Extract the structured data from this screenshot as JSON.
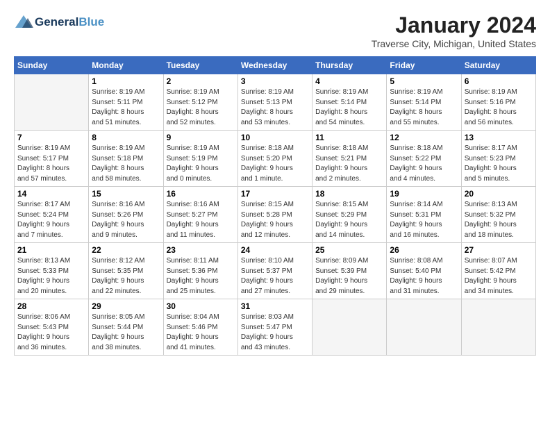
{
  "header": {
    "logo_line1": "General",
    "logo_line2": "Blue",
    "month_title": "January 2024",
    "location": "Traverse City, Michigan, United States"
  },
  "days_of_week": [
    "Sunday",
    "Monday",
    "Tuesday",
    "Wednesday",
    "Thursday",
    "Friday",
    "Saturday"
  ],
  "weeks": [
    [
      {
        "day": "",
        "info": ""
      },
      {
        "day": "1",
        "info": "Sunrise: 8:19 AM\nSunset: 5:11 PM\nDaylight: 8 hours\nand 51 minutes."
      },
      {
        "day": "2",
        "info": "Sunrise: 8:19 AM\nSunset: 5:12 PM\nDaylight: 8 hours\nand 52 minutes."
      },
      {
        "day": "3",
        "info": "Sunrise: 8:19 AM\nSunset: 5:13 PM\nDaylight: 8 hours\nand 53 minutes."
      },
      {
        "day": "4",
        "info": "Sunrise: 8:19 AM\nSunset: 5:14 PM\nDaylight: 8 hours\nand 54 minutes."
      },
      {
        "day": "5",
        "info": "Sunrise: 8:19 AM\nSunset: 5:14 PM\nDaylight: 8 hours\nand 55 minutes."
      },
      {
        "day": "6",
        "info": "Sunrise: 8:19 AM\nSunset: 5:16 PM\nDaylight: 8 hours\nand 56 minutes."
      }
    ],
    [
      {
        "day": "7",
        "info": "Sunrise: 8:19 AM\nSunset: 5:17 PM\nDaylight: 8 hours\nand 57 minutes."
      },
      {
        "day": "8",
        "info": "Sunrise: 8:19 AM\nSunset: 5:18 PM\nDaylight: 8 hours\nand 58 minutes."
      },
      {
        "day": "9",
        "info": "Sunrise: 8:19 AM\nSunset: 5:19 PM\nDaylight: 9 hours\nand 0 minutes."
      },
      {
        "day": "10",
        "info": "Sunrise: 8:18 AM\nSunset: 5:20 PM\nDaylight: 9 hours\nand 1 minute."
      },
      {
        "day": "11",
        "info": "Sunrise: 8:18 AM\nSunset: 5:21 PM\nDaylight: 9 hours\nand 2 minutes."
      },
      {
        "day": "12",
        "info": "Sunrise: 8:18 AM\nSunset: 5:22 PM\nDaylight: 9 hours\nand 4 minutes."
      },
      {
        "day": "13",
        "info": "Sunrise: 8:17 AM\nSunset: 5:23 PM\nDaylight: 9 hours\nand 5 minutes."
      }
    ],
    [
      {
        "day": "14",
        "info": "Sunrise: 8:17 AM\nSunset: 5:24 PM\nDaylight: 9 hours\nand 7 minutes."
      },
      {
        "day": "15",
        "info": "Sunrise: 8:16 AM\nSunset: 5:26 PM\nDaylight: 9 hours\nand 9 minutes."
      },
      {
        "day": "16",
        "info": "Sunrise: 8:16 AM\nSunset: 5:27 PM\nDaylight: 9 hours\nand 11 minutes."
      },
      {
        "day": "17",
        "info": "Sunrise: 8:15 AM\nSunset: 5:28 PM\nDaylight: 9 hours\nand 12 minutes."
      },
      {
        "day": "18",
        "info": "Sunrise: 8:15 AM\nSunset: 5:29 PM\nDaylight: 9 hours\nand 14 minutes."
      },
      {
        "day": "19",
        "info": "Sunrise: 8:14 AM\nSunset: 5:31 PM\nDaylight: 9 hours\nand 16 minutes."
      },
      {
        "day": "20",
        "info": "Sunrise: 8:13 AM\nSunset: 5:32 PM\nDaylight: 9 hours\nand 18 minutes."
      }
    ],
    [
      {
        "day": "21",
        "info": "Sunrise: 8:13 AM\nSunset: 5:33 PM\nDaylight: 9 hours\nand 20 minutes."
      },
      {
        "day": "22",
        "info": "Sunrise: 8:12 AM\nSunset: 5:35 PM\nDaylight: 9 hours\nand 22 minutes."
      },
      {
        "day": "23",
        "info": "Sunrise: 8:11 AM\nSunset: 5:36 PM\nDaylight: 9 hours\nand 25 minutes."
      },
      {
        "day": "24",
        "info": "Sunrise: 8:10 AM\nSunset: 5:37 PM\nDaylight: 9 hours\nand 27 minutes."
      },
      {
        "day": "25",
        "info": "Sunrise: 8:09 AM\nSunset: 5:39 PM\nDaylight: 9 hours\nand 29 minutes."
      },
      {
        "day": "26",
        "info": "Sunrise: 8:08 AM\nSunset: 5:40 PM\nDaylight: 9 hours\nand 31 minutes."
      },
      {
        "day": "27",
        "info": "Sunrise: 8:07 AM\nSunset: 5:42 PM\nDaylight: 9 hours\nand 34 minutes."
      }
    ],
    [
      {
        "day": "28",
        "info": "Sunrise: 8:06 AM\nSunset: 5:43 PM\nDaylight: 9 hours\nand 36 minutes."
      },
      {
        "day": "29",
        "info": "Sunrise: 8:05 AM\nSunset: 5:44 PM\nDaylight: 9 hours\nand 38 minutes."
      },
      {
        "day": "30",
        "info": "Sunrise: 8:04 AM\nSunset: 5:46 PM\nDaylight: 9 hours\nand 41 minutes."
      },
      {
        "day": "31",
        "info": "Sunrise: 8:03 AM\nSunset: 5:47 PM\nDaylight: 9 hours\nand 43 minutes."
      },
      {
        "day": "",
        "info": ""
      },
      {
        "day": "",
        "info": ""
      },
      {
        "day": "",
        "info": ""
      }
    ]
  ]
}
